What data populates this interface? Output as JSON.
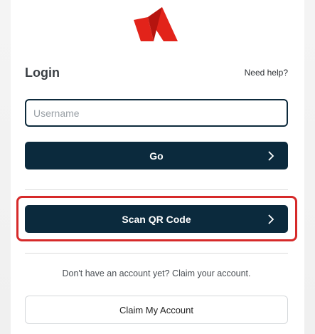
{
  "login": {
    "title": "Login",
    "help_link": "Need help?",
    "username_placeholder": "Username",
    "username_value": "",
    "go_label": "Go",
    "scan_label": "Scan QR Code"
  },
  "signup": {
    "prompt": "Don't have an account yet? Claim your account.",
    "claim_label": "Claim My Account"
  },
  "colors": {
    "logo_red": "#e2231a",
    "button_dark": "#0b2a3d",
    "highlight_red": "#d62a2a"
  }
}
